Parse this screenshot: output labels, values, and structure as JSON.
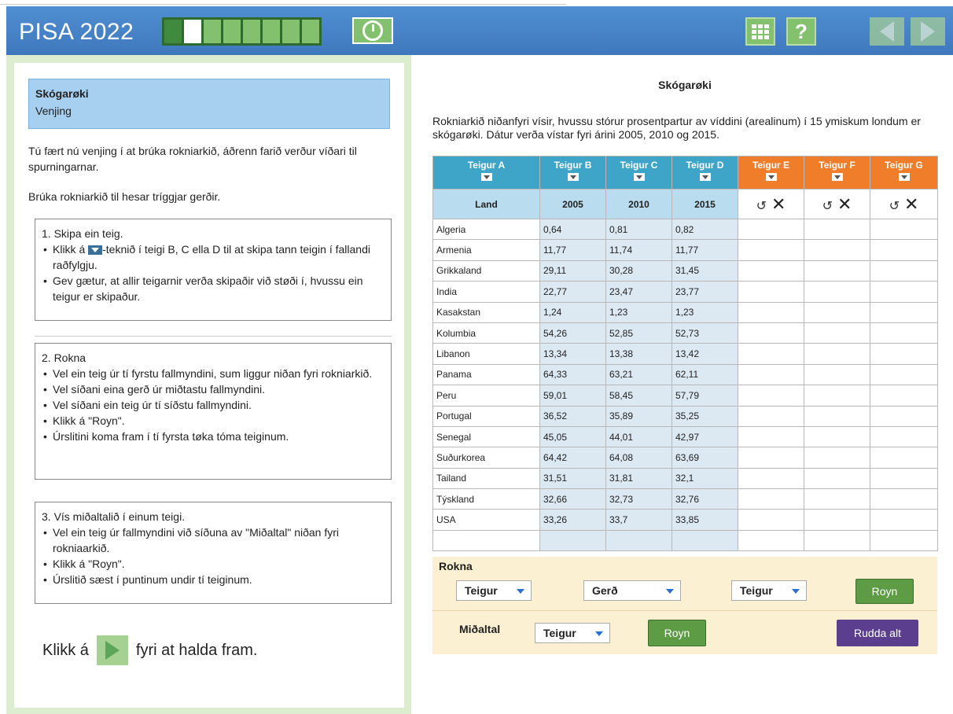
{
  "header": {
    "title": "PISA 2022",
    "progress": {
      "segments": 9,
      "done": 1,
      "current_index": 1
    }
  },
  "left": {
    "title": "Skógarøki",
    "subtitle": "Venjing",
    "intro": "Tú fært nú venjing í at brúka rokniarkið, áðrenn farið verður víðari til spurningarnar.",
    "instruction": "Brúka rokniarkið til hesar tríggjar gerðir.",
    "step1": {
      "heading": "1. Skipa ein teig.",
      "b1_pre": "Klikk á ",
      "b1_post": "-teknið í teigi B, C ella D til at skipa tann teigin í fallandi raðfylgju.",
      "b2": "Gev gætur, at allir teigarnir verða skipaðir við støði í, hvussu ein teigur er skipaður."
    },
    "step2": {
      "heading": "2. Rokna",
      "items": [
        "Vel ein teig úr tí fyrstu fallmyndini, sum liggur niðan fyri rokniarkið.",
        "Vel síðani eina gerð úr miðtastu fallmyndini.",
        "Vel síðani ein teig úr tí síðstu fallmyndini.",
        "Klikk á \"Royn\".",
        "Úrslitini koma fram í tí fyrsta tøka tóma teiginum."
      ]
    },
    "step3": {
      "heading": "3. Vís miðaltalið í einum teigi.",
      "items": [
        "Vel ein teig úr fallmyndini við síðuna av \"Miðaltal\" niðan fyri rokniaarkið.",
        "Klikk á \"Royn\".",
        "Úrslitið sæst í puntinum undir tí teiginum."
      ]
    },
    "continue_pre": "Klikk á",
    "continue_post": "fyri at halda fram."
  },
  "right": {
    "title": "Skógarøki",
    "description": "Rokniarkið niðanfyri vísir, hvussu stórur prosentpartur av víddini (arealinum) í 15 ymiskum londum er skógarøki. Dátur verða vístar fyri árini 2005, 2010 og 2015.",
    "columns": [
      "Teigur A",
      "Teigur B",
      "Teigur C",
      "Teigur D",
      "Teigur E",
      "Teigur F",
      "Teigur G"
    ],
    "subheaders": [
      "Land",
      "2005",
      "2010",
      "2015"
    ],
    "rows": [
      [
        "Algeria",
        "0,64",
        "0,81",
        "0,82"
      ],
      [
        "Armenia",
        "11,77",
        "11,74",
        "11,77"
      ],
      [
        "Grikkaland",
        "29,11",
        "30,28",
        "31,45"
      ],
      [
        "India",
        "22,77",
        "23,47",
        "23,77"
      ],
      [
        "Kasakstan",
        "1,24",
        "1,23",
        "1,23"
      ],
      [
        "Kolumbia",
        "54,26",
        "52,85",
        "52,73"
      ],
      [
        "Libanon",
        "13,34",
        "13,38",
        "13,42"
      ],
      [
        "Panama",
        "64,33",
        "63,21",
        "62,11"
      ],
      [
        "Peru",
        "59,01",
        "58,45",
        "57,79"
      ],
      [
        "Portugal",
        "36,52",
        "35,89",
        "35,25"
      ],
      [
        "Senegal",
        "45,05",
        "44,01",
        "42,97"
      ],
      [
        "Suðurkorea",
        "64,42",
        "64,08",
        "63,69"
      ],
      [
        "Tailand",
        "31,51",
        "31,81",
        "32,1"
      ],
      [
        "Týskland",
        "32,66",
        "32,73",
        "32,76"
      ],
      [
        "USA",
        "33,26",
        "33,7",
        "33,85"
      ]
    ],
    "rokna": {
      "label": "Rokna",
      "select1": "Teigur",
      "select2": "Gerð",
      "select3": "Teigur",
      "button": "Royn"
    },
    "midaltal": {
      "label": "Miðaltal",
      "select": "Teigur",
      "button": "Royn",
      "clear": "Rudda alt"
    }
  },
  "colors": {
    "header_blue": "#3f78bd",
    "blue_column": "#3ea5c8",
    "orange_column": "#f07d2a",
    "green_button": "#5e9b45",
    "purple_button": "#5b3e8e"
  },
  "icons": [
    "timer-icon",
    "calculator-icon",
    "help-icon",
    "back-arrow-icon",
    "forward-arrow-icon",
    "sort-dropdown-icon",
    "undo-icon",
    "clear-icon",
    "play-icon"
  ]
}
